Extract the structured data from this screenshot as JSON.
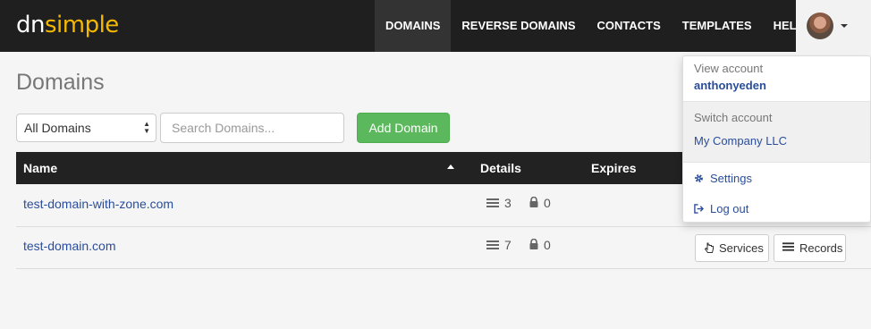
{
  "logo": {
    "part1": "dn",
    "part2": "simple"
  },
  "nav": {
    "items": [
      {
        "label": "DOMAINS"
      },
      {
        "label": "REVERSE DOMAINS"
      },
      {
        "label": "CONTACTS"
      },
      {
        "label": "TEMPLATES"
      },
      {
        "label": "HELP"
      }
    ],
    "active": "DOMAINS"
  },
  "page": {
    "title": "Domains"
  },
  "filters": {
    "select_value": "All Domains",
    "search_placeholder": "Search Domains...",
    "add_button": "Add Domain"
  },
  "table": {
    "columns": [
      "Name",
      "Details",
      "Expires"
    ],
    "rows": [
      {
        "name": "test-domain-with-zone.com",
        "records": "3",
        "locks": "0"
      },
      {
        "name": "test-domain.com",
        "records": "7",
        "locks": "0"
      }
    ],
    "row_buttons": {
      "services": "Services",
      "records": "Records"
    }
  },
  "account_menu": {
    "view_label": "View account",
    "username": "anthonyeden",
    "switch_label": "Switch account",
    "company": "My Company LLC",
    "settings": "Settings",
    "logout": "Log out"
  },
  "colors": {
    "topbar": "#1f1f1f",
    "brand_yellow": "#f5b800",
    "link_blue": "#2a4d9b",
    "add_green": "#5cb85c"
  }
}
